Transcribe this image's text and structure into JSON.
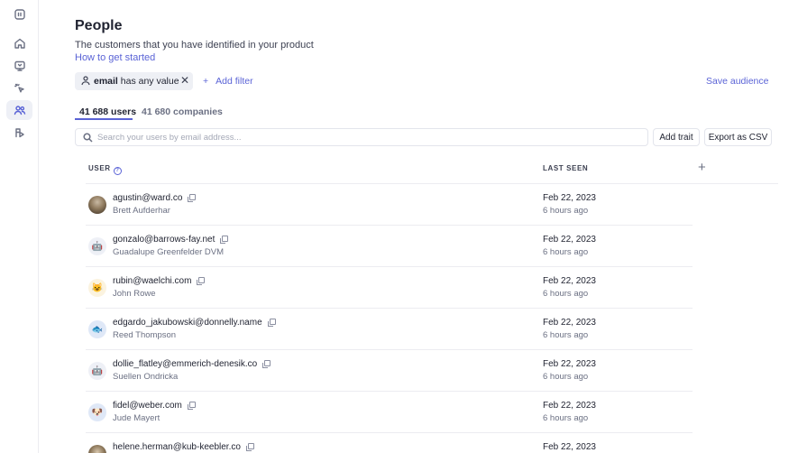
{
  "sidebar": {
    "items": [
      {
        "icon": "app-logo-icon"
      },
      {
        "icon": "home-icon"
      },
      {
        "icon": "inbox-icon"
      },
      {
        "icon": "click-icon"
      },
      {
        "icon": "people-icon",
        "active": true
      },
      {
        "icon": "integrations-icon"
      }
    ]
  },
  "page": {
    "title": "People",
    "subtitle": "The customers that you have identified in your product",
    "help_link": "How to get started"
  },
  "filter": {
    "field": "email",
    "condition": " has any value",
    "add_filter_label": "Add filter",
    "save_audience_label": "Save audience"
  },
  "tabs": {
    "users": "41 688 users",
    "companies": "41 680 companies"
  },
  "search": {
    "placeholder": "Search your users by email address..."
  },
  "toolbar": {
    "add_trait": "Add trait",
    "export_csv": "Export as CSV"
  },
  "table": {
    "columns": {
      "user": "USER",
      "last_seen": "LAST SEEN"
    },
    "rows": [
      {
        "email": "agustin@ward.co",
        "name": "Brett Aufderhar",
        "date": "Feb 22, 2023",
        "ago": "6 hours ago",
        "avatar": "photo"
      },
      {
        "email": "gonzalo@barrows-fay.net",
        "name": "Guadalupe Greenfelder DVM",
        "date": "Feb 22, 2023",
        "ago": "6 hours ago",
        "avatar": "🤖"
      },
      {
        "email": "rubin@waelchi.com",
        "name": "John Rowe",
        "date": "Feb 22, 2023",
        "ago": "6 hours ago",
        "avatar": "😺"
      },
      {
        "email": "edgardo_jakubowski@donnelly.name",
        "name": "Reed Thompson",
        "date": "Feb 22, 2023",
        "ago": "6 hours ago",
        "avatar": "🐟"
      },
      {
        "email": "dollie_flatley@emmerich-denesik.co",
        "name": "Suellen Ondricka",
        "date": "Feb 22, 2023",
        "ago": "6 hours ago",
        "avatar": "🤖"
      },
      {
        "email": "fidel@weber.com",
        "name": "Jude Mayert",
        "date": "Feb 22, 2023",
        "ago": "6 hours ago",
        "avatar": "🐶"
      },
      {
        "email": "helene.herman@kub-keebler.co",
        "name": "",
        "date": "Feb 22, 2023",
        "ago": "",
        "avatar": "photo"
      }
    ]
  },
  "colors": {
    "accent": "#5a63d6",
    "text": "#1f2230",
    "muted": "#6b7083",
    "border": "#ececf1"
  }
}
